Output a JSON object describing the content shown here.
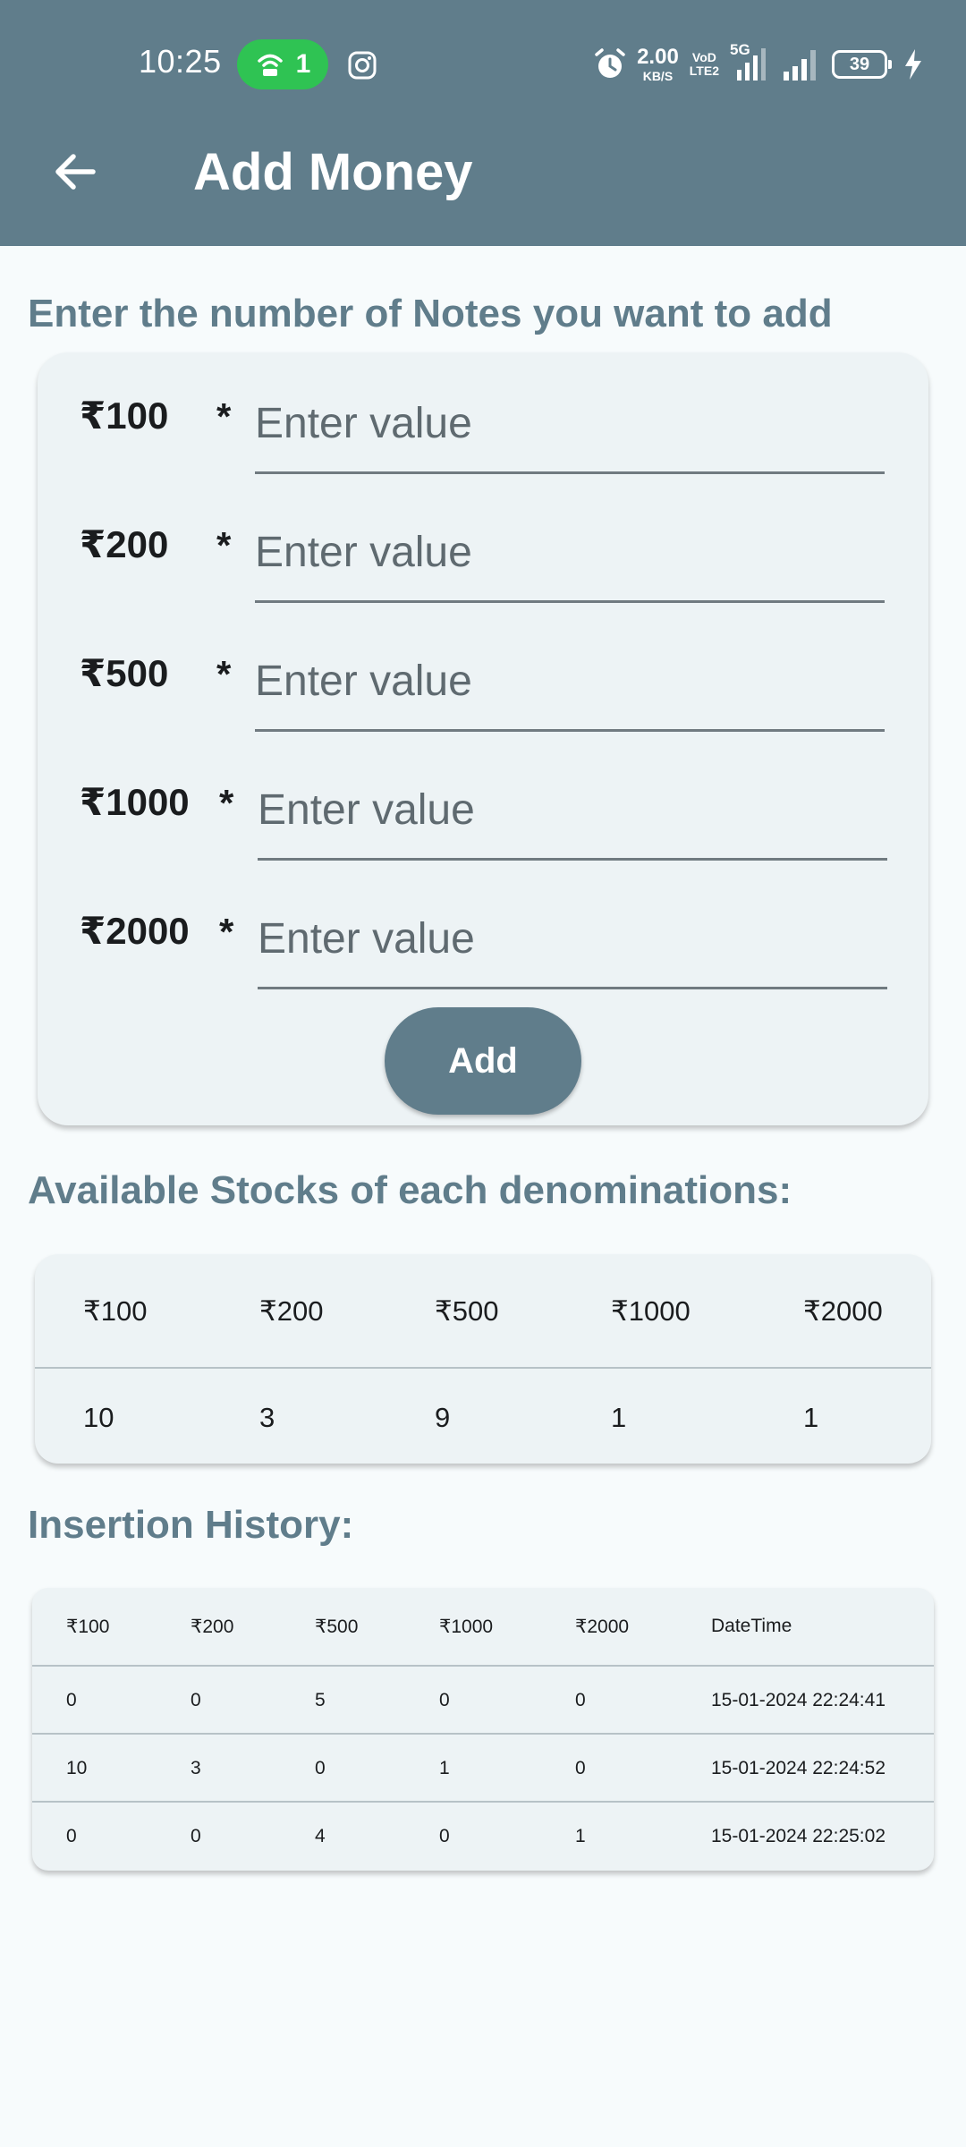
{
  "status_bar": {
    "time": "10:25",
    "hotspot_count": "1",
    "net_speed": "2.00",
    "net_speed_unit": "KB/S",
    "volte_line1": "VoD",
    "volte_line2": "LTE2",
    "network_type": "5G",
    "battery_level": "39"
  },
  "app_bar": {
    "title": "Add Money"
  },
  "form": {
    "heading": "Enter the number of Notes you want to add",
    "required_marker": "*",
    "placeholder": "Enter value",
    "rows": [
      {
        "label": "₹100",
        "value": ""
      },
      {
        "label": "₹200",
        "value": ""
      },
      {
        "label": "₹500",
        "value": ""
      },
      {
        "label": "₹1000",
        "value": ""
      },
      {
        "label": "₹2000",
        "value": ""
      }
    ],
    "add_label": "Add"
  },
  "stocks": {
    "heading": "Available Stocks of each denominations:",
    "columns": [
      "₹100",
      "₹200",
      "₹500",
      "₹1000",
      "₹2000"
    ],
    "values": [
      "10",
      "3",
      "9",
      "1",
      "1"
    ]
  },
  "history": {
    "heading": "Insertion History:",
    "columns": [
      "₹100",
      "₹200",
      "₹500",
      "₹1000",
      "₹2000",
      "DateTime"
    ],
    "rows": [
      [
        "0",
        "0",
        "5",
        "0",
        "0",
        "15-01-2024 22:24:41"
      ],
      [
        "10",
        "3",
        "0",
        "1",
        "0",
        "15-01-2024 22:24:52"
      ],
      [
        "0",
        "0",
        "4",
        "0",
        "1",
        "15-01-2024 22:25:02"
      ]
    ]
  },
  "colors": {
    "primary": "#607d8b",
    "card_background": "#edf3f5",
    "page_background": "#f7fbfc",
    "hotspot_pill": "#2fc353"
  }
}
